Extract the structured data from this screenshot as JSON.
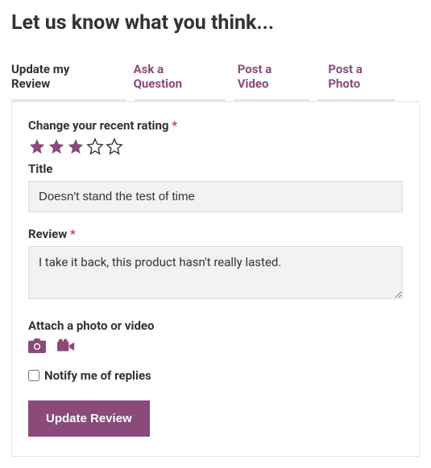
{
  "page_title": "Let us know what you think...",
  "tabs": [
    {
      "label": "Update my Review",
      "active": true
    },
    {
      "label": "Ask a Question",
      "active": false
    },
    {
      "label": "Post a Video",
      "active": false
    },
    {
      "label": "Post a Photo",
      "active": false
    }
  ],
  "form": {
    "rating_label": "Change your recent rating",
    "rating_value": 3,
    "rating_max": 5,
    "title_label": "Title",
    "title_value": "Doesn't stand the test of time",
    "review_label": "Review",
    "review_value": "I take it back, this product hasn't really lasted.",
    "attach_label": "Attach a photo or video",
    "notify_label": "Notify me of replies",
    "notify_checked": false,
    "submit_label": "Update Review"
  },
  "colors": {
    "accent": "#8a4a7a",
    "text": "#333333",
    "required": "#d33"
  }
}
